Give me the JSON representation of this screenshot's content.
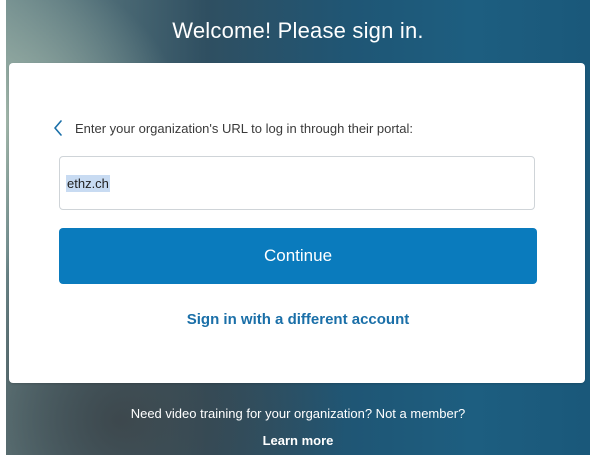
{
  "header": {
    "title": "Welcome! Please sign in."
  },
  "card": {
    "back_icon": "chevron-left-icon",
    "prompt": "Enter your organization's URL to log in through their portal:",
    "org_url": {
      "value": "ethz.ch",
      "selected": true
    },
    "continue_label": "Continue",
    "alt_signin_label": "Sign in with a different account"
  },
  "footer": {
    "text": "Need video training for your organization? Not a member?",
    "link_label": "Learn more"
  },
  "colors": {
    "primary_button": "#0a7bbd",
    "link": "#1a6fa8",
    "selection": "#c8dbf2"
  }
}
